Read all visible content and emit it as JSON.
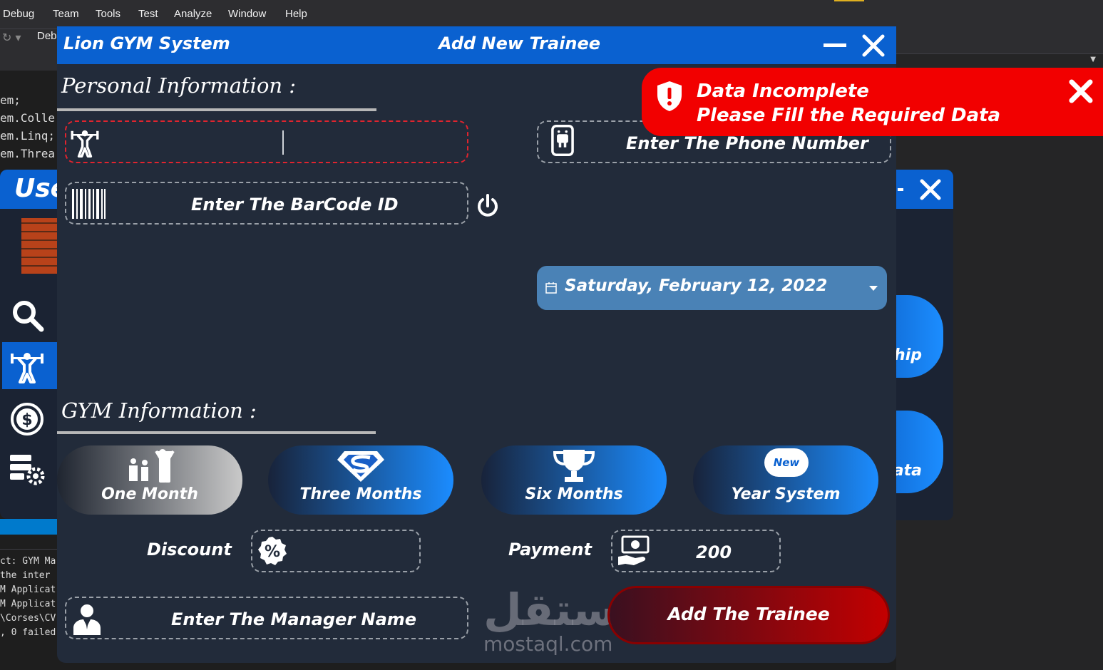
{
  "ide": {
    "menu": [
      "Debug",
      "Team",
      "Tools",
      "Test",
      "Analyze",
      "Window",
      "Help"
    ],
    "toolbar_fragment": "Deb",
    "code_lines": [
      "em;",
      "em.Colle",
      "em.Linq;",
      "em.Threa"
    ],
    "output_lines": [
      "ct: GYM Mar",
      " the inter",
      "M Applicat",
      "M Applicat",
      "\\Corses\\CV",
      ", 0 failed"
    ]
  },
  "background_windows": {
    "left_title_fragment": "Use",
    "right_button_1": "ship",
    "right_button_2": "ata"
  },
  "window": {
    "app_title": "Lion GYM System",
    "form_title": "Add New Trainee"
  },
  "personal": {
    "heading": "Personal Information :",
    "trainee_name_value": "",
    "phone_placeholder": "Enter The Phone Number",
    "barcode_placeholder": "Enter The BarCode ID",
    "date_value": "Saturday, February 12, 2022"
  },
  "gym": {
    "heading": "GYM Information :",
    "plans": [
      {
        "label": "One Month",
        "icon": "family-icon",
        "selected": true
      },
      {
        "label": "Three Months",
        "icon": "superman-icon",
        "selected": false
      },
      {
        "label": "Six Months",
        "icon": "trophy-icon",
        "selected": false
      },
      {
        "label": "Year System",
        "icon": "new-badge-icon",
        "selected": false
      }
    ],
    "new_badge": "New",
    "discount_label": "Discount",
    "discount_value": "",
    "payment_label": "Payment",
    "payment_value": "200",
    "manager_placeholder": "Enter The Manager Name",
    "submit_label": "Add The Trainee"
  },
  "toast": {
    "title": "Data Incomplete",
    "message": "Please Fill the Required Data"
  },
  "watermark": {
    "arabic": "مستقل",
    "latin": "mostaql.com"
  },
  "colors": {
    "title_bar": "#0a61d0",
    "window_bg": "#222b3a",
    "toast_bg": "#f20000",
    "submit_end": "#c30000",
    "date_picker": "#4a82b6"
  }
}
